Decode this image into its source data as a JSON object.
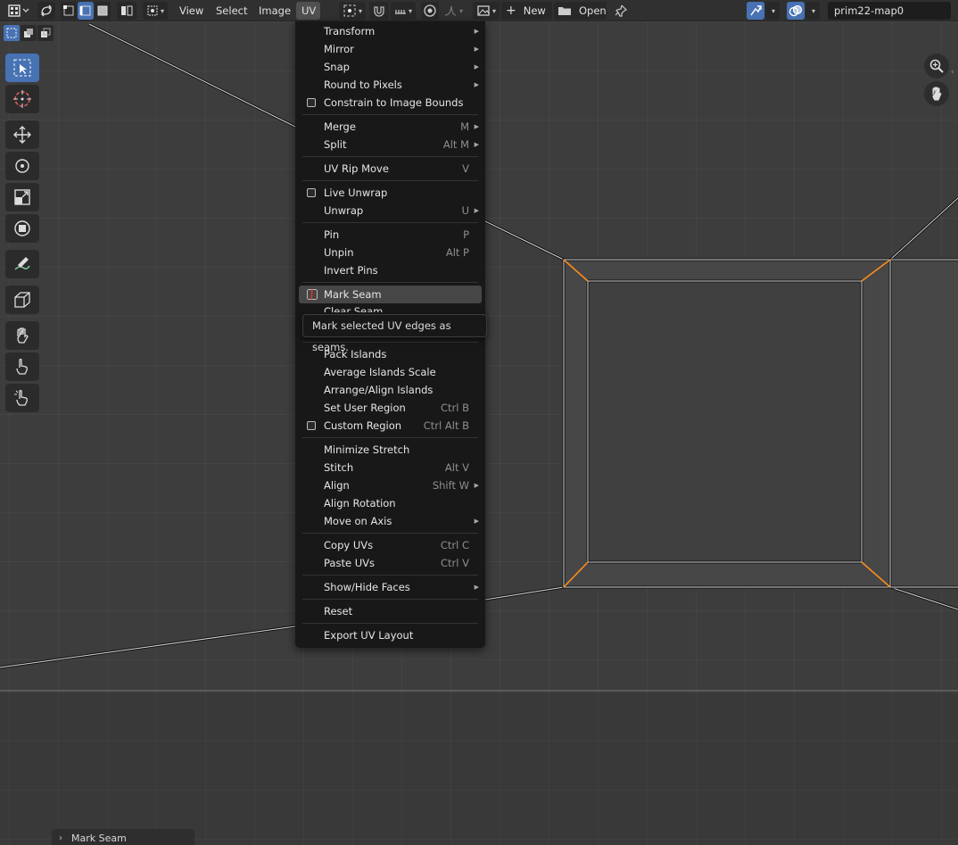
{
  "header": {
    "menus": [
      "View",
      "Select",
      "Image",
      "UV"
    ],
    "new_label": "New",
    "open_label": "Open",
    "image_name": "prim22-map0"
  },
  "uv_menu": {
    "items": [
      {
        "label": "Transform",
        "submenu": true
      },
      {
        "label": "Mirror",
        "submenu": true
      },
      {
        "label": "Snap",
        "submenu": true
      },
      {
        "label": "Round to Pixels",
        "submenu": true
      },
      {
        "label": "Constrain to Image Bounds",
        "checkbox": true
      },
      {
        "label": "Merge",
        "shortcut": "M",
        "submenu": true
      },
      {
        "label": "Split",
        "shortcut": "Alt M",
        "submenu": true
      },
      {
        "label": "UV Rip Move",
        "shortcut": "V"
      },
      {
        "label": "Live Unwrap",
        "checkbox": true
      },
      {
        "label": "Unwrap",
        "shortcut": "U",
        "submenu": true
      },
      {
        "label": "Pin",
        "shortcut": "P"
      },
      {
        "label": "Unpin",
        "shortcut": "Alt P"
      },
      {
        "label": "Invert Pins"
      },
      {
        "label": "Mark Seam",
        "highlighted": true
      },
      {
        "label": "Clear Seam"
      },
      {
        "label": "Pack Islands"
      },
      {
        "label": "Average Islands Scale"
      },
      {
        "label": "Arrange/Align Islands"
      },
      {
        "label": "Set User Region",
        "shortcut": "Ctrl B"
      },
      {
        "label": "Custom Region",
        "shortcut": "Ctrl Alt B",
        "checkbox": true
      },
      {
        "label": "Minimize Stretch"
      },
      {
        "label": "Stitch",
        "shortcut": "Alt V"
      },
      {
        "label": "Align",
        "shortcut": "Shift W",
        "submenu": true
      },
      {
        "label": "Align Rotation"
      },
      {
        "label": "Move on Axis",
        "submenu": true
      },
      {
        "label": "Copy UVs",
        "shortcut": "Ctrl C"
      },
      {
        "label": "Paste UVs",
        "shortcut": "Ctrl V"
      },
      {
        "label": "Show/Hide Faces",
        "submenu": true
      },
      {
        "label": "Reset"
      },
      {
        "label": "Export UV Layout"
      }
    ]
  },
  "tooltip": "Mark selected UV edges as seams.",
  "last_operator": "Mark Seam",
  "colors": {
    "accent": "#4772b3",
    "seam": "#ff8c1a",
    "menu_bg": "#181818",
    "highlight": "#464646"
  }
}
